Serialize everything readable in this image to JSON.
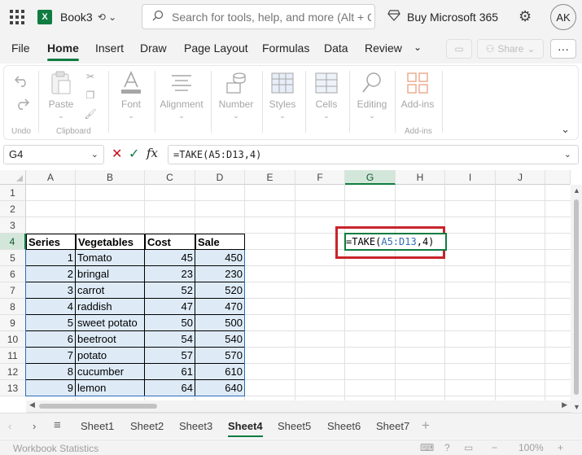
{
  "title": {
    "app_letter": "X",
    "document": "Book3",
    "search_placeholder": "Search for tools, help, and more (Alt + Q)",
    "buy": "Buy Microsoft 365",
    "avatar": "AK"
  },
  "menu": {
    "tabs": [
      "File",
      "Home",
      "Insert",
      "Draw",
      "Page Layout",
      "Formulas",
      "Data",
      "Review"
    ],
    "active": "Home",
    "share": "Share"
  },
  "ribbon": {
    "paste": "Paste",
    "font": "Font",
    "alignment": "Alignment",
    "number": "Number",
    "styles": "Styles",
    "cells": "Cells",
    "editing": "Editing",
    "addins": "Add-ins",
    "group_undo": "Undo",
    "group_clipboard": "Clipboard",
    "group_addins": "Add-ins"
  },
  "formula_bar": {
    "name_box": "G4",
    "formula": "=TAKE(A5:D13,4)"
  },
  "grid": {
    "columns": [
      "A",
      "B",
      "C",
      "D",
      "E",
      "F",
      "G",
      "H",
      "I",
      "J"
    ],
    "rows": [
      "1",
      "2",
      "3",
      "4",
      "5",
      "6",
      "7",
      "8",
      "9",
      "10",
      "11",
      "12",
      "13"
    ],
    "table_headers": [
      "Series",
      "Vegetables",
      "Cost",
      "Sale"
    ],
    "table_rows": [
      [
        "1",
        "Tomato",
        "45",
        "450"
      ],
      [
        "2",
        "bringal",
        "23",
        "230"
      ],
      [
        "3",
        "carrot",
        "52",
        "520"
      ],
      [
        "4",
        "raddish",
        "47",
        "470"
      ],
      [
        "5",
        "sweet potato",
        "50",
        "500"
      ],
      [
        "6",
        "beetroot",
        "54",
        "540"
      ],
      [
        "7",
        "potato",
        "57",
        "570"
      ],
      [
        "8",
        "cucumber",
        "61",
        "610"
      ],
      [
        "9",
        "lemon",
        "64",
        "640"
      ]
    ],
    "editing_cell": {
      "prefix": "=TAKE(",
      "ref": "A5:D13",
      "suffix": ",4)"
    }
  },
  "sheets": {
    "tabs": [
      "Sheet1",
      "Sheet2",
      "Sheet3",
      "Sheet4",
      "Sheet5",
      "Sheet6",
      "Sheet7"
    ],
    "active": "Sheet4"
  },
  "status": {
    "text": "Workbook Statistics",
    "zoom": "100%"
  },
  "colors": {
    "accent": "#107c41",
    "highlight_box": "#c8242b",
    "table_fill": "#deebf7",
    "ref_blue": "#2f6db5"
  }
}
